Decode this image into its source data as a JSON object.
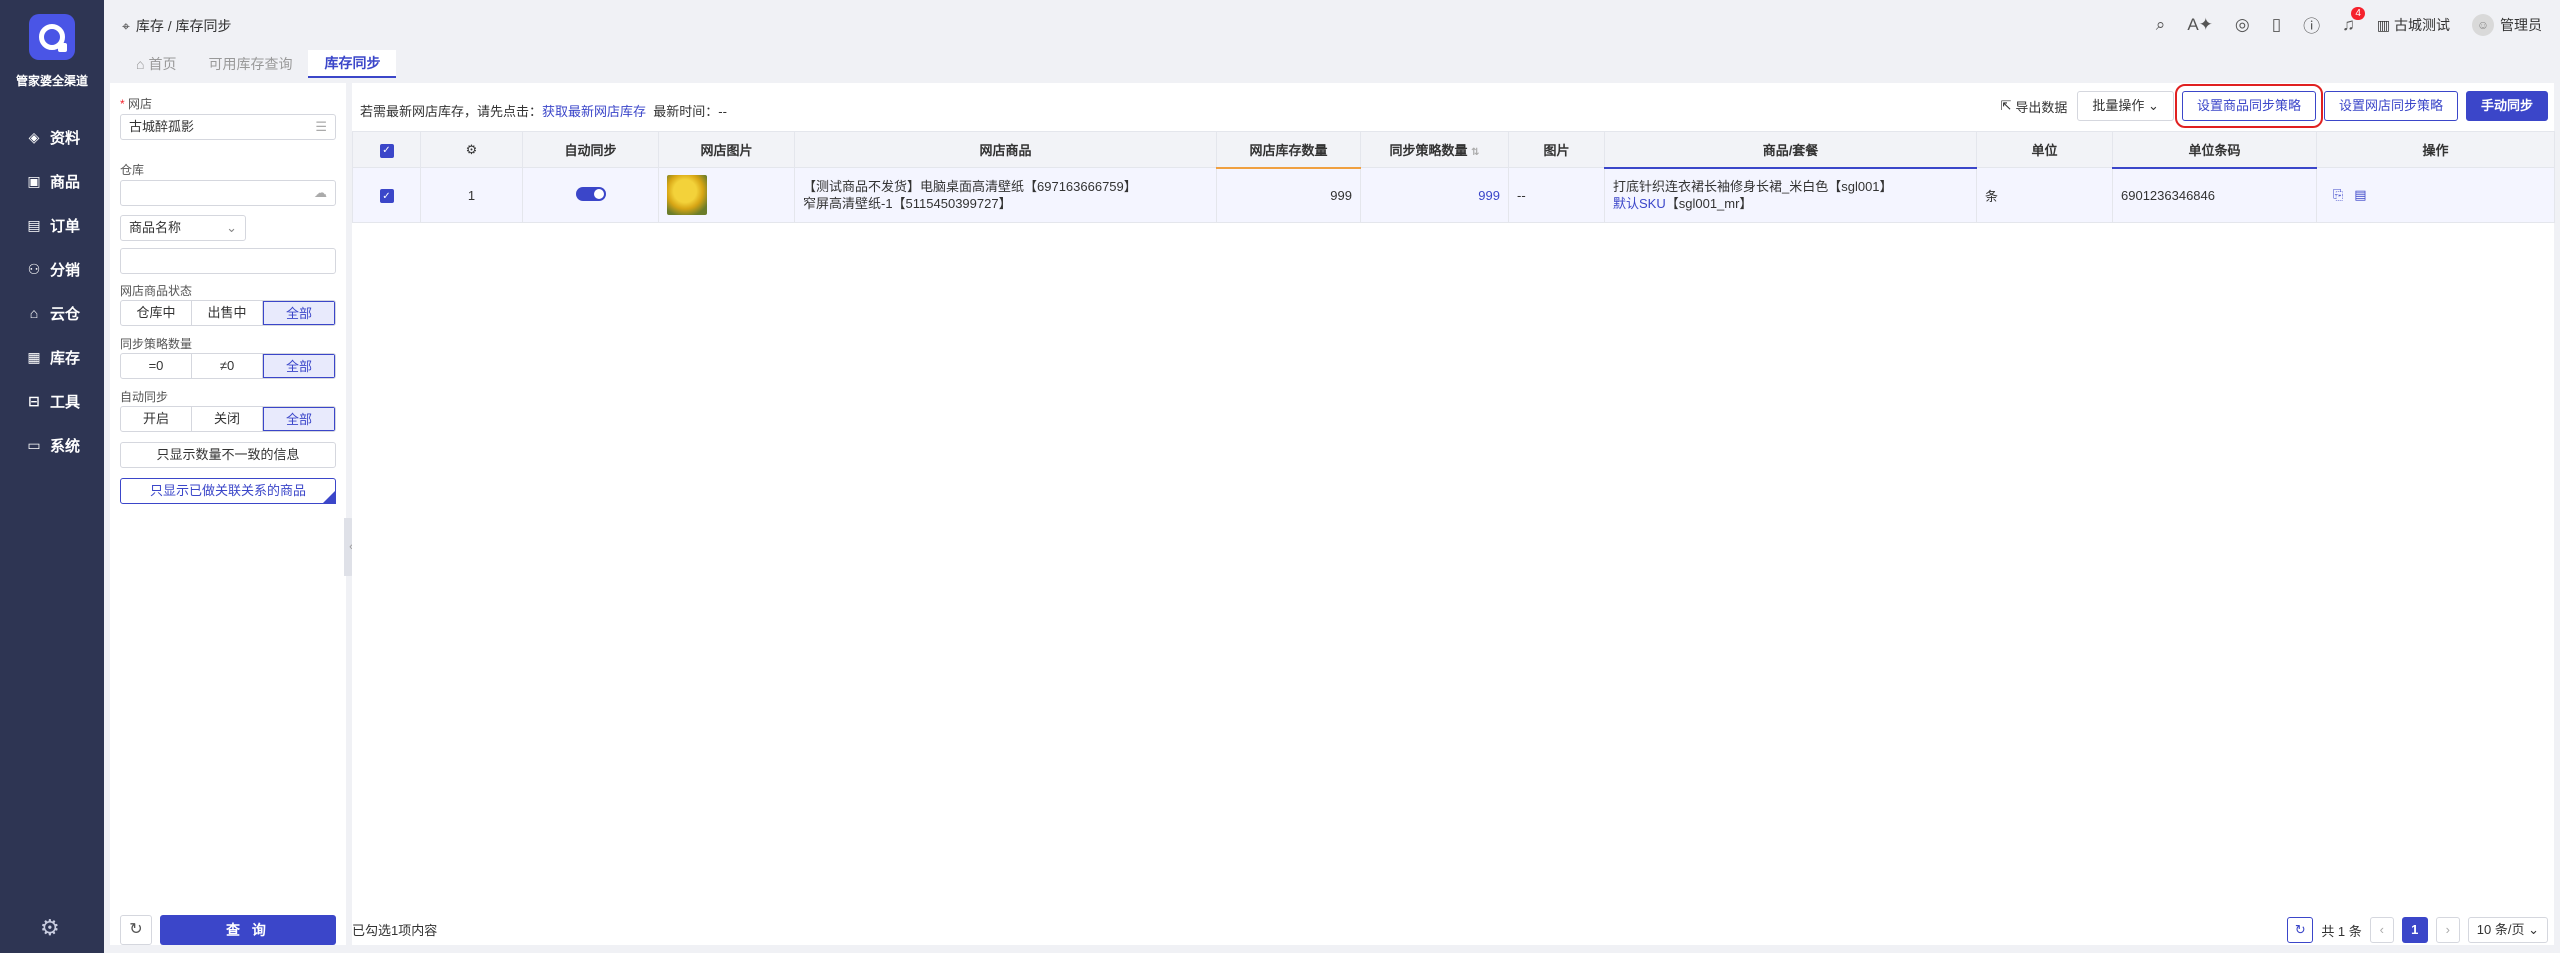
{
  "sidebar": {
    "brand": "管家婆全渠道",
    "items": [
      {
        "label": "资料",
        "icon": "layers-icon"
      },
      {
        "label": "商品",
        "icon": "box-icon"
      },
      {
        "label": "订单",
        "icon": "order-icon"
      },
      {
        "label": "分销",
        "icon": "distribution-icon"
      },
      {
        "label": "云仓",
        "icon": "cloud-warehouse-icon"
      },
      {
        "label": "库存",
        "icon": "inventory-icon"
      },
      {
        "label": "工具",
        "icon": "toolbox-icon"
      },
      {
        "label": "系统",
        "icon": "monitor-icon"
      }
    ]
  },
  "header": {
    "breadcrumb": "库存 / 库存同步",
    "notification_count": "4",
    "company": "古城测试",
    "user": "管理员"
  },
  "tabs": [
    "首页",
    "可用库存查询",
    "库存同步"
  ],
  "filters": {
    "shop_label": "网店",
    "shop_value": "古城醉孤影",
    "warehouse_label": "仓库",
    "warehouse_value": "",
    "product_field": "商品名称",
    "product_value": "",
    "status_label": "网店商品状态",
    "status_options": [
      "仓库中",
      "出售中",
      "全部"
    ],
    "strategy_label": "同步策略数量",
    "strategy_options": [
      "=0",
      "≠0",
      "全部"
    ],
    "autosync_label": "自动同步",
    "autosync_options": [
      "开启",
      "关闭",
      "全部"
    ],
    "only_mismatch": "只显示数量不一致的信息",
    "only_linked": "只显示已做关联关系的商品",
    "query_button": "查 询"
  },
  "toolbar": {
    "tip_prefix": "若需最新网店库存，请先点击：",
    "tip_link": "获取最新网店库存",
    "tip_time": "最新时间：--",
    "export": "导出数据",
    "batch": "批量操作",
    "set_product_strategy": "设置商品同步策略",
    "set_shop_strategy": "设置网店同步策略",
    "manual_sync": "手动同步"
  },
  "table": {
    "headers": [
      "自动同步",
      "网店图片",
      "网店商品",
      "网店库存数量",
      "同步策略数量",
      "图片",
      "商品/套餐",
      "单位",
      "单位条码",
      "操作"
    ],
    "rows": [
      {
        "index": "1",
        "product_line1": "【测试商品不发货】电脑桌面高清壁纸【697163666759】",
        "product_line2": "窄屏高清壁纸-1【5115450399727】",
        "shop_stock": "999",
        "strategy_qty": "999",
        "image": "--",
        "goods_line1": "打底针织连衣裙长袖修身长裙_米白色【sgl001】",
        "goods_sku": "默认SKU",
        "goods_code": "【sgl001_mr】",
        "unit": "条",
        "barcode": "6901236346846"
      }
    ]
  },
  "footer": {
    "selected": "已勾选1项内容",
    "total": "共 1 条",
    "page": "1",
    "page_size": "10 条/页"
  }
}
